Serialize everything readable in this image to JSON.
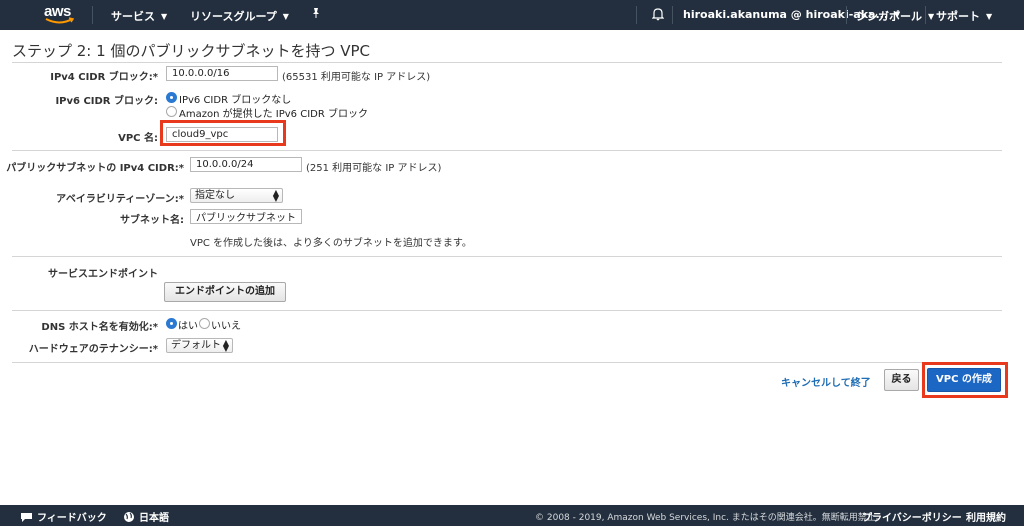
{
  "topnav": {
    "logo": "aws",
    "services": "サービス",
    "resource_groups": "リソースグループ",
    "account": "hiroaki.akanuma @ hiroaki-aka...",
    "region": "シンガポール",
    "support": "サポート",
    "icons": {
      "pin": "pin-icon",
      "bell": "bell-icon",
      "caret": "caret-down-icon"
    }
  },
  "page": {
    "title": "ステップ 2: 1 個のパブリックサブネットを持つ VPC"
  },
  "form": {
    "ipv4_cidr": {
      "label": "IPv4 CIDR ブロック:*",
      "value": "10.0.0.0/16",
      "hint": "(65531 利用可能な IP アドレス)"
    },
    "ipv6_cidr": {
      "label": "IPv6 CIDR ブロック:",
      "options": [
        "IPv6 CIDR ブロックなし",
        "Amazon が提供した IPv6 CIDR ブロック"
      ],
      "selected": 0
    },
    "vpc_name": {
      "label": "VPC 名:",
      "value": "cloud9_vpc"
    },
    "public_subnet_cidr": {
      "label": "パブリックサブネットの IPv4 CIDR:*",
      "value": "10.0.0.0/24",
      "hint": "(251 利用可能な IP アドレス)"
    },
    "availability_zone": {
      "label": "アベイラビリティーゾーン:*",
      "value": "指定なし"
    },
    "subnet_name": {
      "label": "サブネット名:",
      "value": "パブリックサブネット",
      "note": "VPC を作成した後は、より多くのサブネットを追加できます。"
    },
    "service_endpoints": {
      "label": "サービスエンドポイント",
      "add_button": "エンドポイントの追加"
    },
    "dns_hostnames": {
      "label": "DNS ホスト名を有効化:*",
      "options": [
        "はい",
        "いいえ"
      ],
      "selected": 0
    },
    "tenancy": {
      "label": "ハードウェアのテナンシー:*",
      "value": "デフォルト"
    }
  },
  "actions": {
    "cancel": "キャンセルして終了",
    "back": "戻る",
    "create": "VPC の作成"
  },
  "footer": {
    "feedback": "フィードバック",
    "language": "日本語",
    "copyright": "© 2008 - 2019, Amazon Web Services, Inc. またはその関連会社。無断転用禁止。",
    "privacy": "プライバシーポリシー",
    "terms": "利用規約"
  },
  "colors": {
    "nav_bg": "#232f3e",
    "primary_button": "#1d67c4",
    "highlight": "#e8391d",
    "link": "#1e6cb4"
  }
}
